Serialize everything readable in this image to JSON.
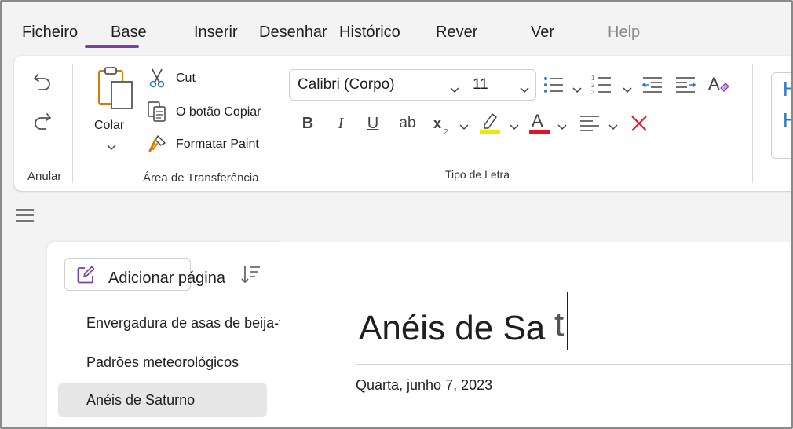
{
  "menu": {
    "tabs": [
      "Ficheiro",
      "Base",
      "Inserir",
      "Desenhar",
      "Histórico",
      "Rever",
      "Ver",
      "Help"
    ],
    "active_tab": "Base"
  },
  "ribbon": {
    "undo_group_label": "Anular",
    "clipboard": {
      "paste_label": "Colar",
      "cut_label": "Cut",
      "copy_label": "O botão Copiar",
      "format_paint_label": "Formatar Paint",
      "group_label": "Área de Transferência"
    },
    "font": {
      "font_name": "Calibri (Corpo)",
      "font_size": "11",
      "group_label": "Tipo de Letra",
      "highlight_color": "#f5e400",
      "font_color": "#e81123",
      "clear_color": "#e81123"
    },
    "side_letters": [
      "H",
      "H"
    ]
  },
  "pages_panel": {
    "add_page_label": "Adicionar página",
    "pages": [
      {
        "title": "Envergadura de asas de beija-flor",
        "selected": false
      },
      {
        "title": "Padrões meteorológicos",
        "selected": false
      },
      {
        "title": "Anéis de Saturno",
        "selected": true
      }
    ]
  },
  "page": {
    "title": "Anéis de Sa",
    "title_tail": "t",
    "date": "Quarta, junho 7, 2023"
  },
  "colors": {
    "accent": "#7e3ea9",
    "icon_blue": "#2b78c5"
  }
}
